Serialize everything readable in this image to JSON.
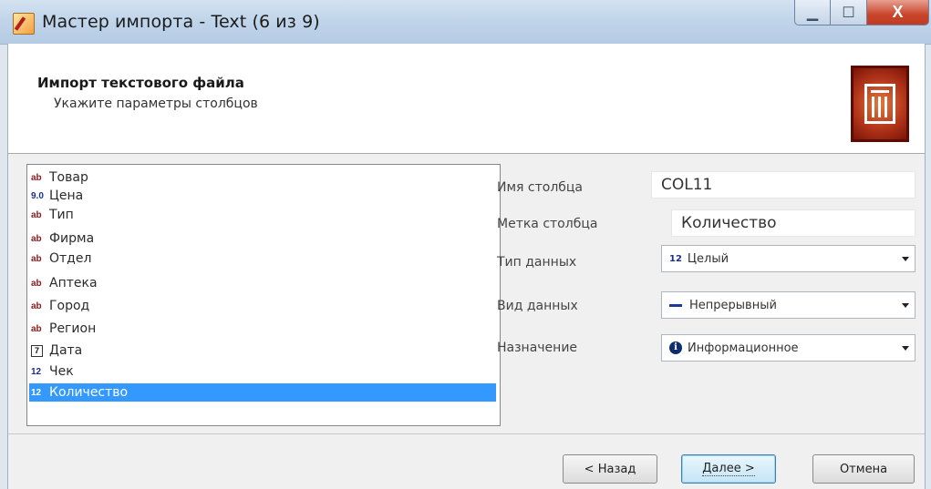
{
  "window": {
    "title": "Мастер импорта - Text (6 из 9)",
    "controls": {
      "minimize": "▁",
      "maximize": "☐",
      "close": "X"
    }
  },
  "header": {
    "title": "Импорт текстового файла",
    "subtitle": "Укажите параметры столбцов",
    "logo_icon": "database-table-icon"
  },
  "columns": [
    {
      "icon": "ab",
      "icon_name": "text-type-icon",
      "label": "Товар"
    },
    {
      "icon": "9.0",
      "icon_name": "float-type-icon",
      "label": "Цена"
    },
    {
      "icon": "ab",
      "icon_name": "text-type-icon",
      "label": "Тип"
    },
    {
      "icon": "ab",
      "icon_name": "text-type-icon",
      "label": "Фирма"
    },
    {
      "icon": "ab",
      "icon_name": "text-type-icon",
      "label": "Отдел"
    },
    {
      "icon": "ab",
      "icon_name": "text-type-icon",
      "label": "Аптека"
    },
    {
      "icon": "ab",
      "icon_name": "text-type-icon",
      "label": "Город"
    },
    {
      "icon": "ab",
      "icon_name": "text-type-icon",
      "label": "Регион"
    },
    {
      "icon": "7",
      "icon_name": "calendar-icon",
      "label": "Дата"
    },
    {
      "icon": "12",
      "icon_name": "integer-type-icon",
      "label": "Чек"
    },
    {
      "icon": "12",
      "icon_name": "integer-type-icon",
      "label": "Количество",
      "selected": true
    }
  ],
  "properties": {
    "column_name": {
      "label": "Имя столбца",
      "value": "COL11"
    },
    "column_caption": {
      "label": "Метка столбца",
      "value": "Количество"
    },
    "data_type": {
      "label": "Тип данных",
      "icon": "12",
      "value": "Целый"
    },
    "data_kind": {
      "label": "Вид данных",
      "icon_name": "continuous-dash-icon",
      "value": "Непрерывный"
    },
    "purpose": {
      "label": "Назначение",
      "icon": "i",
      "icon_name": "info-icon",
      "value": "Информационное"
    }
  },
  "buttons": {
    "back": "< Назад",
    "next": "Далее >",
    "cancel": "Отмена"
  },
  "colors": {
    "selection": "#3399ff",
    "text_type_icon": "#8b1a1a",
    "number_type_icon": "#1a2f8b",
    "logo": "#b5371b"
  }
}
